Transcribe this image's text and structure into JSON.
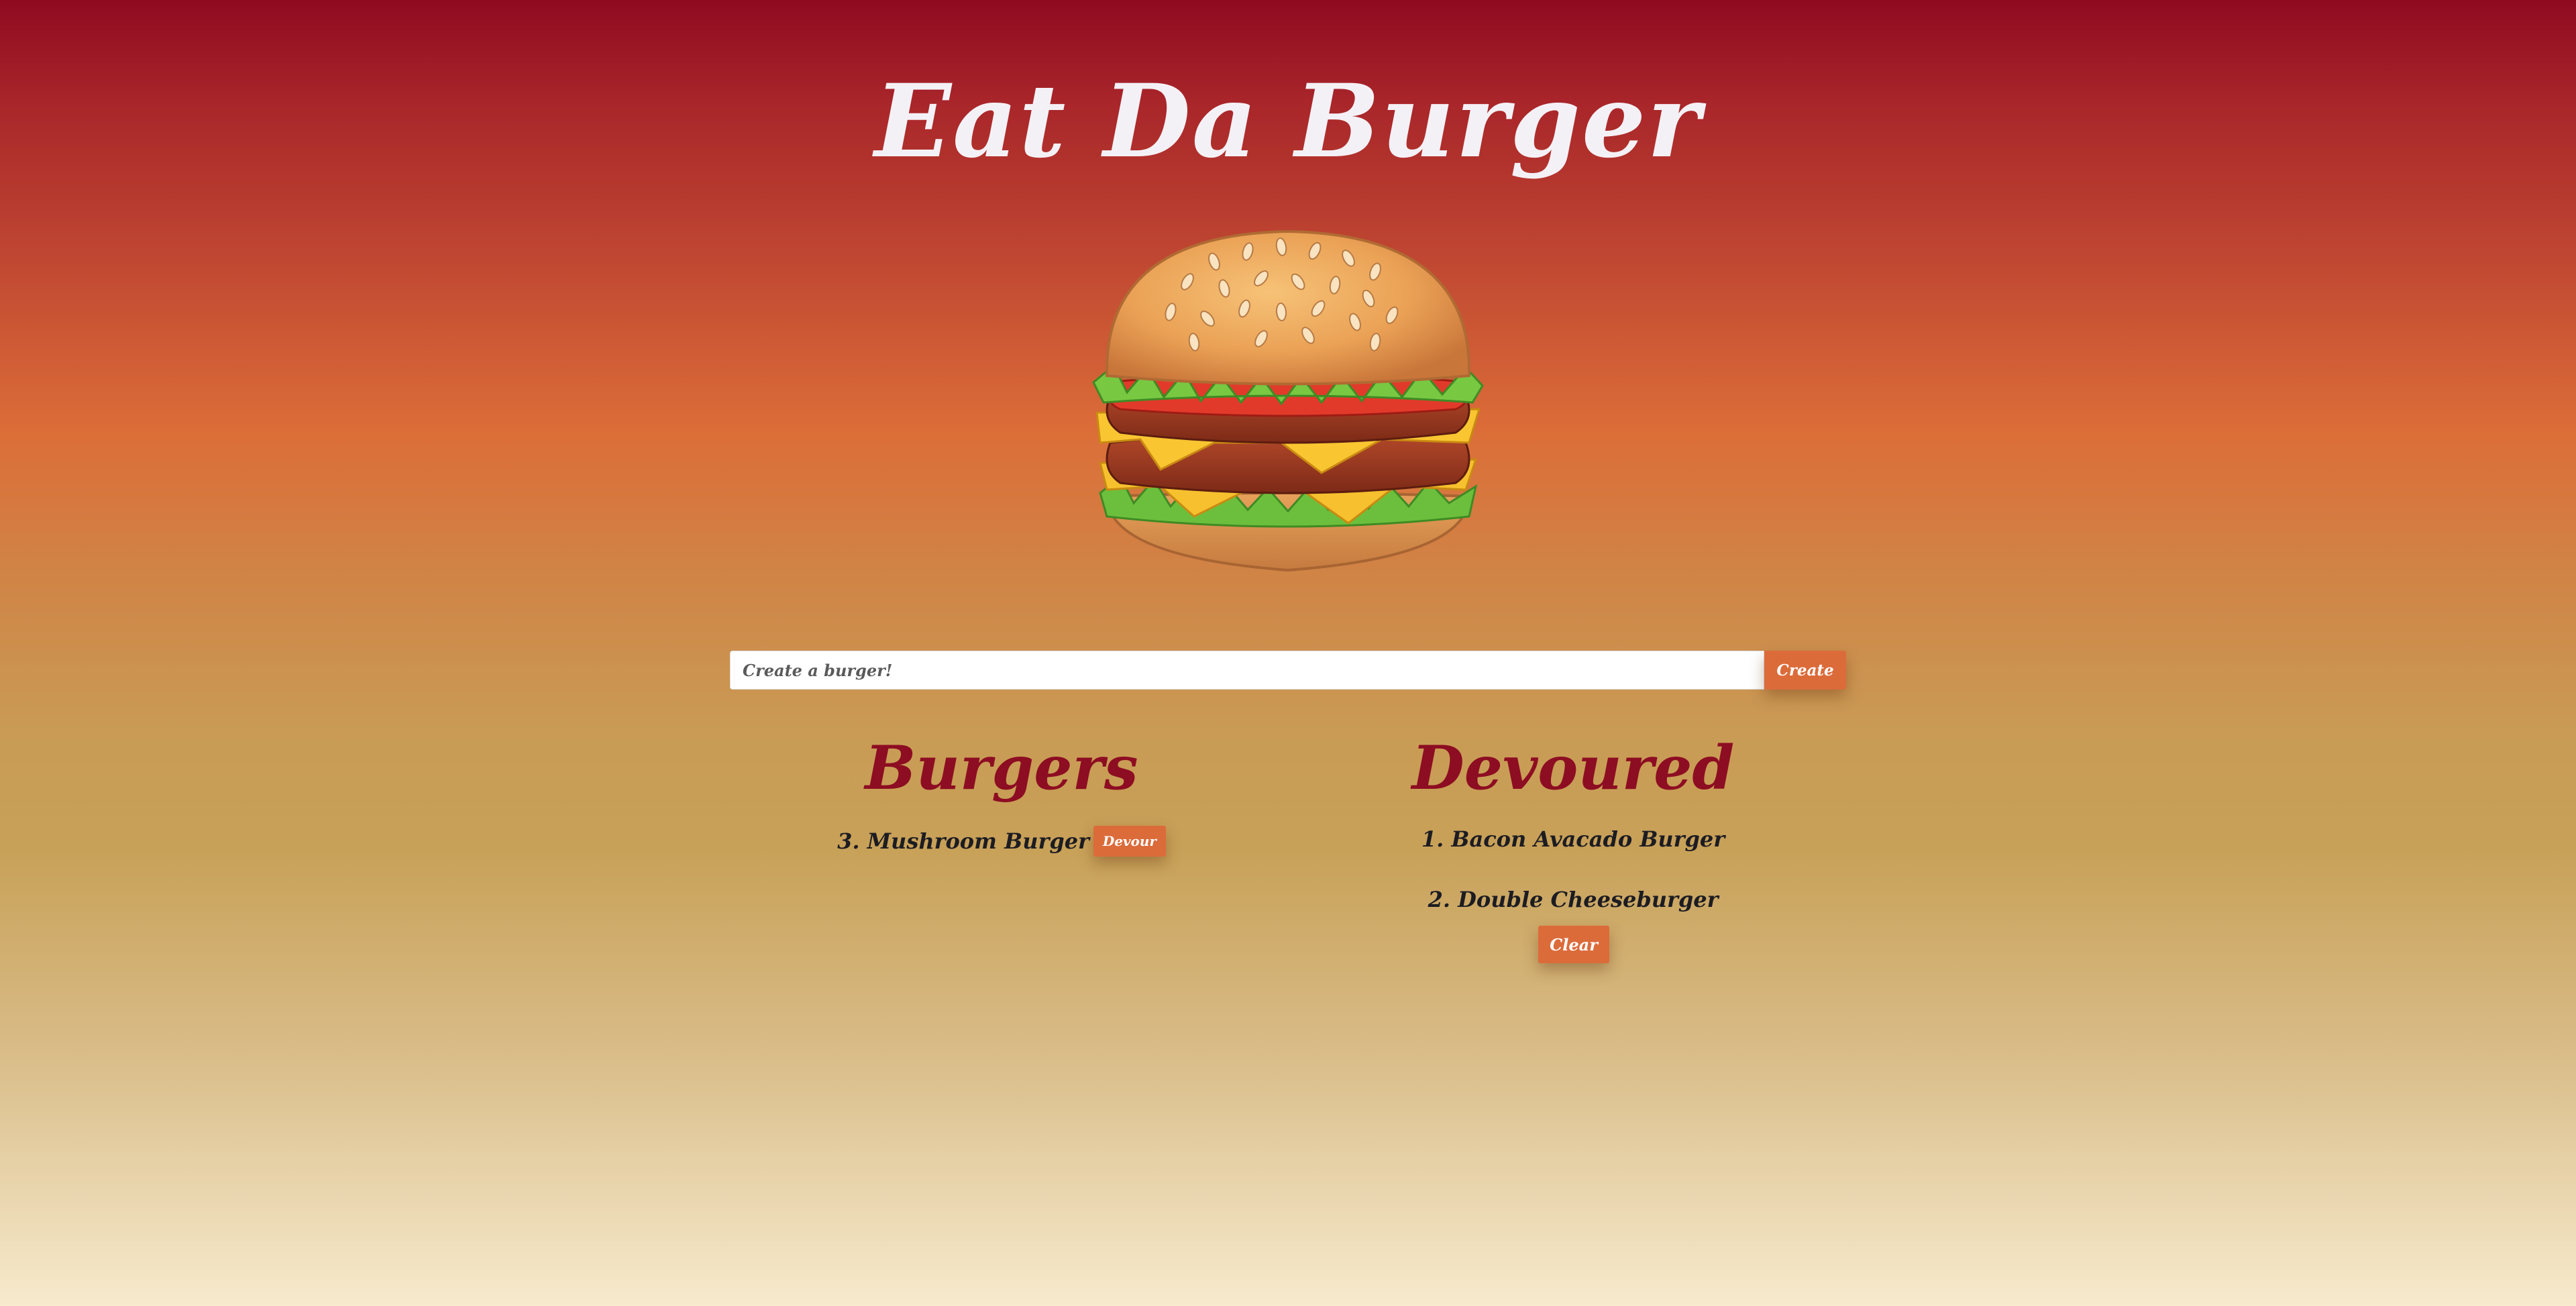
{
  "header": {
    "title": "Eat Da Burger"
  },
  "form": {
    "placeholder": "Create a burger!",
    "value": "",
    "create_label": "Create"
  },
  "burgers": {
    "title": "Burgers",
    "items": [
      {
        "label": "3. Mushroom Burger",
        "action_label": "Devour"
      }
    ]
  },
  "devoured": {
    "title": "Devoured",
    "items": [
      {
        "label": "1. Bacon Avacado Burger"
      },
      {
        "label": "2. Double Cheeseburger"
      }
    ],
    "clear_label": "Clear"
  },
  "colors": {
    "accent": "#dc6b3a",
    "heading": "#8d0d22",
    "title": "#f4f1f6"
  },
  "icons": {
    "hero": "burger-illustration"
  }
}
